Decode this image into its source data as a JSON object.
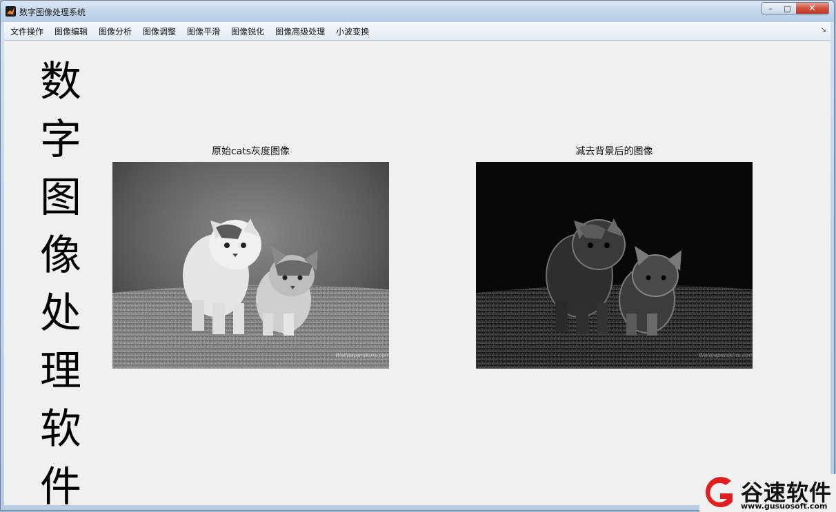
{
  "window": {
    "title": "数字图像处理系统",
    "controls": {
      "minimize": "–",
      "maximize": "□",
      "close": "✕"
    }
  },
  "menubar": {
    "items": [
      "文件操作",
      "图像编辑",
      "图像分析",
      "图像调整",
      "图像平滑",
      "图像锐化",
      "图像高级处理",
      "小波变换"
    ],
    "overflow_icon": "arrow-icon"
  },
  "sidebar_title": {
    "chars": [
      "数",
      "字",
      "图",
      "像",
      "处",
      "理",
      "软",
      "件"
    ]
  },
  "panels": {
    "left": {
      "title": "原始cats灰度图像",
      "image": "two kittens on grass, grayscale",
      "watermark_text": "Wallpaperskins.com"
    },
    "right": {
      "title": "减去背景后的图像",
      "image": "two kittens on grass, background subtracted (dark)",
      "watermark_text": "Wallpaperskins.com"
    }
  },
  "site_watermark": {
    "logo_letter": "G",
    "name": "谷速软件",
    "url": "www.gusuosoft.com",
    "brand_color": "#e02020"
  }
}
